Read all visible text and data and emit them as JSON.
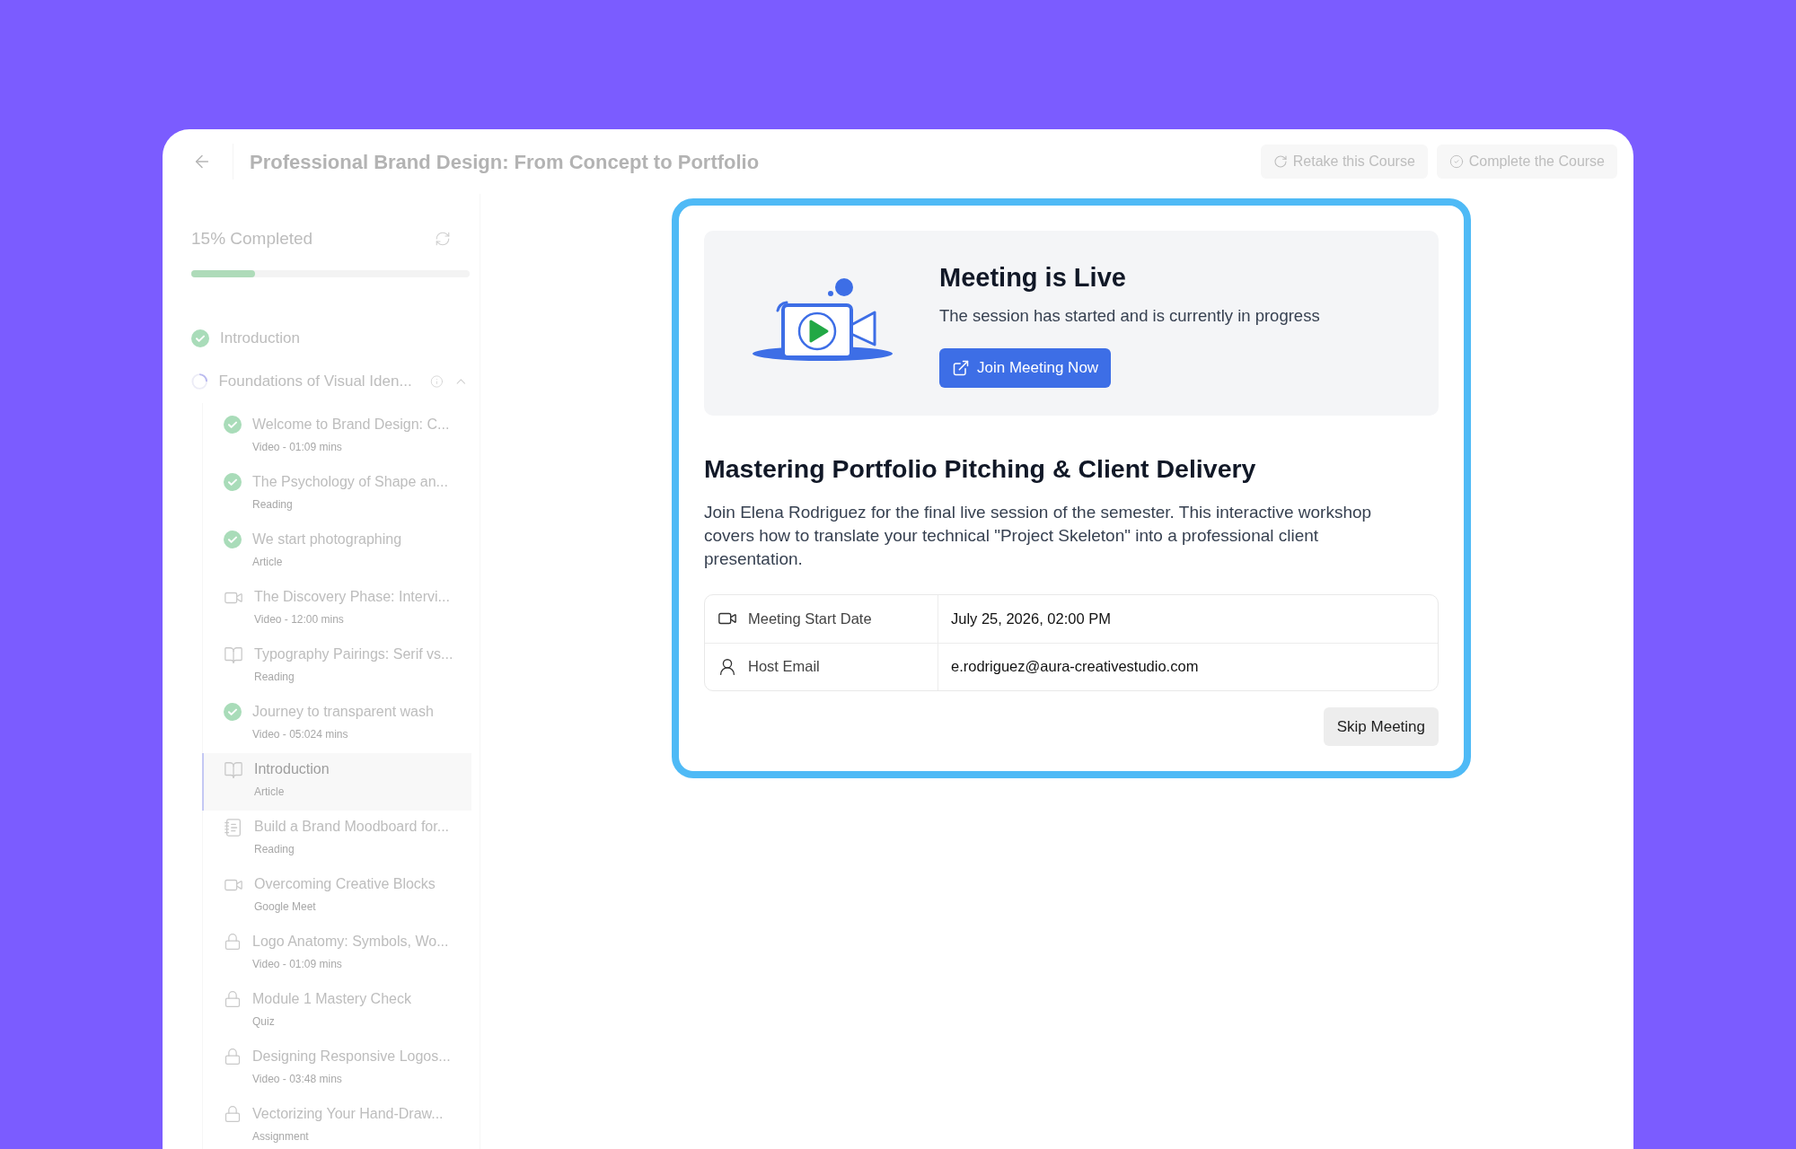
{
  "header": {
    "title": "Professional Brand Design: From Concept to Portfolio",
    "buttons": [
      {
        "label": "Retake this Course",
        "kind": "retake"
      },
      {
        "label": "Complete the Course",
        "kind": "complete"
      }
    ]
  },
  "sidebar": {
    "progress_label": "15% Completed",
    "progress": {
      "level": 0.23
    },
    "sections": [
      {
        "title": "Introduction",
        "kind": "done"
      },
      {
        "title": "Foundations of Visual Iden...",
        "kind": "in_progress",
        "expanded": true,
        "children": [
          {
            "title": "Welcome to Brand Design: C...",
            "meta": "Video - 01:09 mins",
            "kind": "done",
            "selected": false
          },
          {
            "title": "The Psychology of Shape an...",
            "meta": "Reading",
            "kind": "done",
            "selected": false
          },
          {
            "title": "We start photographing",
            "meta": "Article",
            "kind": "done",
            "selected": false
          },
          {
            "title": "The Discovery Phase: Intervi...",
            "meta": "Video - 12:00 mins",
            "kind": "video",
            "selected": false
          },
          {
            "title": "Typography Pairings: Serif vs...",
            "meta": "Reading",
            "kind": "book",
            "selected": false
          },
          {
            "title": "Journey to transparent wash",
            "meta": "Video - 05:024 mins",
            "kind": "done",
            "selected": false
          },
          {
            "title": "Introduction",
            "meta": "Article",
            "kind": "book",
            "selected": true
          },
          {
            "title": "Build a Brand Moodboard for...",
            "meta": "Reading",
            "kind": "document",
            "selected": false
          },
          {
            "title": "Overcoming Creative Blocks",
            "meta": "Google Meet",
            "kind": "video",
            "selected": false
          },
          {
            "title": "Logo Anatomy: Symbols, Wo...",
            "meta": "Video - 01:09 mins",
            "kind": "locked",
            "selected": false
          },
          {
            "title": "Module 1 Mastery Check",
            "meta": "Quiz",
            "kind": "locked",
            "selected": false
          },
          {
            "title": "Designing Responsive Logos...",
            "meta": "Video - 03:48 mins",
            "kind": "locked",
            "selected": false
          },
          {
            "title": "Vectorizing Your Hand-Draw...",
            "meta": "Assignment",
            "kind": "locked",
            "selected": false
          }
        ]
      }
    ]
  },
  "meeting": {
    "status_title": "Meeting is Live",
    "status_text": "The session has started and is currently in progress",
    "join_button": "Join Meeting Now",
    "title": "Mastering Portfolio Pitching & Client Delivery",
    "description": "Join Elena Rodriguez for the final live session of the semester. This interactive workshop covers how to translate your technical \"Project Skeleton\" into a professional client presentation.",
    "details": [
      {
        "kind": "date",
        "label": "Meeting Start Date",
        "value": "July 25, 2026, 02:00 PM"
      },
      {
        "kind": "host",
        "label": "Host Email",
        "value": "e.rodriguez@aura-creativestudio.com"
      }
    ],
    "skip_button": "Skip Meeting"
  }
}
